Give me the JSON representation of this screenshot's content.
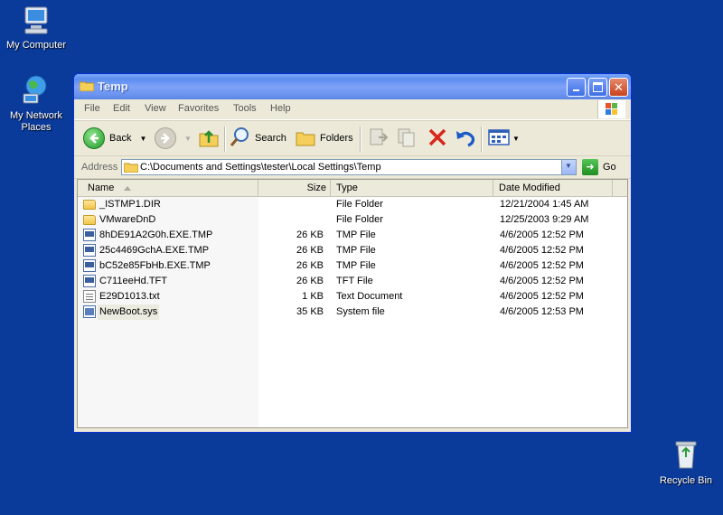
{
  "desktop": {
    "icons": [
      {
        "label": "My Computer"
      },
      {
        "label": "My Network Places"
      },
      {
        "label": "Recycle Bin"
      }
    ]
  },
  "window": {
    "title": "Temp",
    "menu": [
      "File",
      "Edit",
      "View",
      "Favorites",
      "Tools",
      "Help"
    ],
    "toolbar": {
      "back_label": "Back",
      "search_label": "Search",
      "folders_label": "Folders"
    },
    "address": {
      "label": "Address",
      "path": "C:\\Documents and Settings\\tester\\Local Settings\\Temp",
      "go_label": "Go"
    },
    "columns": {
      "name": "Name",
      "size": "Size",
      "type": "Type",
      "date": "Date Modified"
    },
    "files": [
      {
        "name": "_ISTMP1.DIR",
        "size": "",
        "type": "File Folder",
        "date": "12/21/2004 1:45 AM",
        "icon": "folder-icon"
      },
      {
        "name": "VMwareDnD",
        "size": "",
        "type": "File Folder",
        "date": "12/25/2003 9:29 AM",
        "icon": "folder-icon"
      },
      {
        "name": "8hDE91A2G0h.EXE.TMP",
        "size": "26 KB",
        "type": "TMP File",
        "date": "4/6/2005 12:52 PM",
        "icon": "file-icon"
      },
      {
        "name": "25c4469GchA.EXE.TMP",
        "size": "26 KB",
        "type": "TMP File",
        "date": "4/6/2005 12:52 PM",
        "icon": "file-icon"
      },
      {
        "name": "bC52e85FbHb.EXE.TMP",
        "size": "26 KB",
        "type": "TMP File",
        "date": "4/6/2005 12:52 PM",
        "icon": "file-icon"
      },
      {
        "name": "C711eeHd.TFT",
        "size": "26 KB",
        "type": "TFT File",
        "date": "4/6/2005 12:52 PM",
        "icon": "file-icon"
      },
      {
        "name": "E29D1013.txt",
        "size": "1 KB",
        "type": "Text Document",
        "date": "4/6/2005 12:52 PM",
        "icon": "text-file-icon"
      },
      {
        "name": "NewBoot.sys",
        "size": "35 KB",
        "type": "System file",
        "date": "4/6/2005 12:53 PM",
        "icon": "system-file-icon"
      }
    ]
  },
  "colors": {
    "desktop": "#0a3a9a",
    "titlebar": "#5b8ef0",
    "window_chrome": "#ece9d8"
  }
}
